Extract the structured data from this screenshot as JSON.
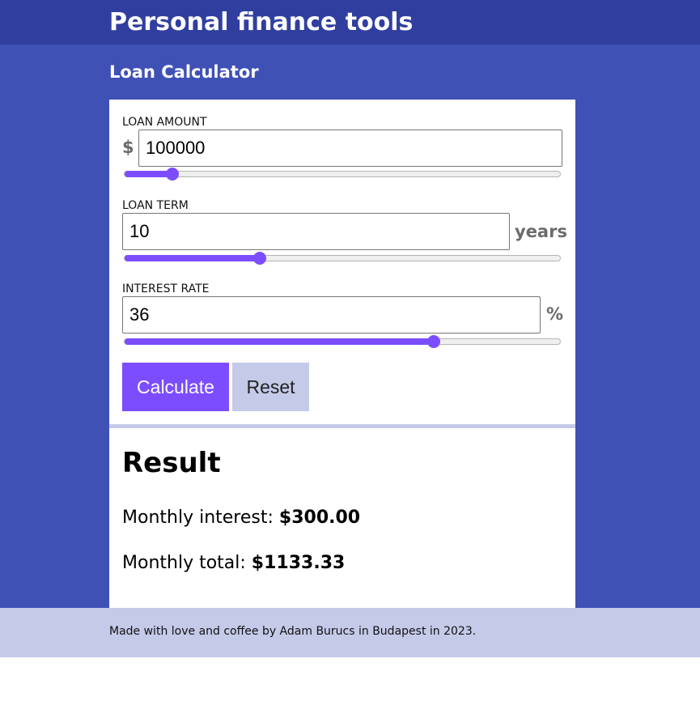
{
  "app": {
    "title": "Personal finance tools"
  },
  "page": {
    "title": "Loan Calculator"
  },
  "form": {
    "loan_amount": {
      "label": "LOAN AMOUNT",
      "prefix": "$",
      "value": "100000",
      "slider_fraction": 0.11
    },
    "loan_term": {
      "label": "LOAN TERM",
      "suffix": "years",
      "value": "10",
      "slider_fraction": 0.31
    },
    "interest_rate": {
      "label": "INTEREST RATE",
      "suffix": "%",
      "value": "36",
      "slider_fraction": 0.71
    },
    "calculate_label": "Calculate",
    "reset_label": "Reset"
  },
  "result": {
    "title": "Result",
    "monthly_interest_label": "Monthly interest:",
    "monthly_interest_value": "$300.00",
    "monthly_total_label": "Monthly total:",
    "monthly_total_value": "$1133.33"
  },
  "footer": {
    "text": "Made with love and coffee by Adam Burucs in Budapest in 2023."
  },
  "colors": {
    "header": "#303f9f",
    "primary": "#3f51b5",
    "accent": "#7c4dff",
    "light": "#c5cae9"
  }
}
